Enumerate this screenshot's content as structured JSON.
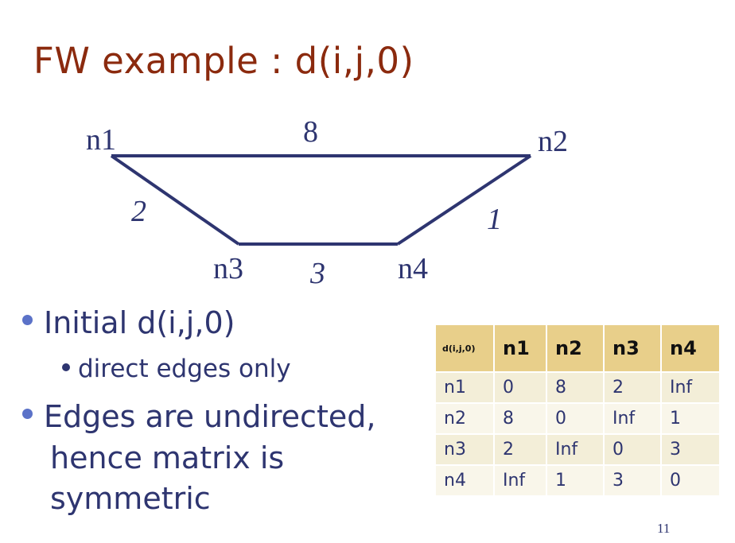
{
  "title": "FW example : d(i,j,0)",
  "graph": {
    "nodes": [
      "n1",
      "n2",
      "n3",
      "n4"
    ],
    "edges": [
      {
        "from": "n1",
        "to": "n2",
        "weight": "8"
      },
      {
        "from": "n1",
        "to": "n3",
        "weight": "2"
      },
      {
        "from": "n3",
        "to": "n4",
        "weight": "3"
      },
      {
        "from": "n4",
        "to": "n2",
        "weight": "1"
      }
    ]
  },
  "bullets": [
    {
      "text": "Initial d(i,j,0)",
      "sub": [
        "direct edges only"
      ]
    },
    {
      "text_lines": [
        "Edges are undirected,",
        "hence matrix is",
        "symmetric"
      ]
    }
  ],
  "matrix": {
    "corner": "d(i,j,0)",
    "headers": [
      "n1",
      "n2",
      "n3",
      "n4"
    ],
    "rows": [
      {
        "label": "n1",
        "cells": [
          "0",
          "8",
          "2",
          "Inf"
        ]
      },
      {
        "label": "n2",
        "cells": [
          "8",
          "0",
          "Inf",
          "1"
        ]
      },
      {
        "label": "n3",
        "cells": [
          "2",
          "Inf",
          "0",
          "3"
        ]
      },
      {
        "label": "n4",
        "cells": [
          "Inf",
          "1",
          "3",
          "0"
        ]
      }
    ]
  },
  "page_number": "11",
  "colors": {
    "title": "#8b2a0e",
    "text": "#2e3570",
    "header_bg": "#e8cf8a"
  }
}
